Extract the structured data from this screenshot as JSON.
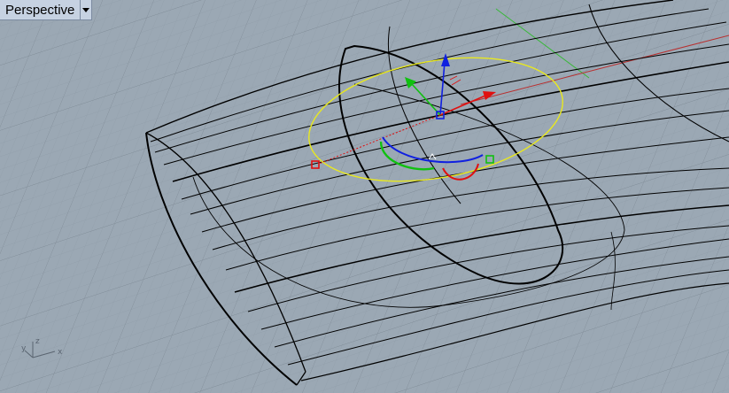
{
  "viewport": {
    "title": "Perspective",
    "menu_icon": "chevron-down-icon"
  },
  "world_axes": {
    "x_label": "x",
    "y_label": "y",
    "z_label": "z"
  },
  "colors": {
    "background": "#9ba8b4",
    "grid_minor": "#8e9ba7",
    "grid_major": "#7f8b96",
    "wireframe": "#000000",
    "gumball_x": "#e01010",
    "gumball_y": "#10c010",
    "gumball_z": "#1020e0",
    "selection_ellipse": "#e8e820"
  }
}
